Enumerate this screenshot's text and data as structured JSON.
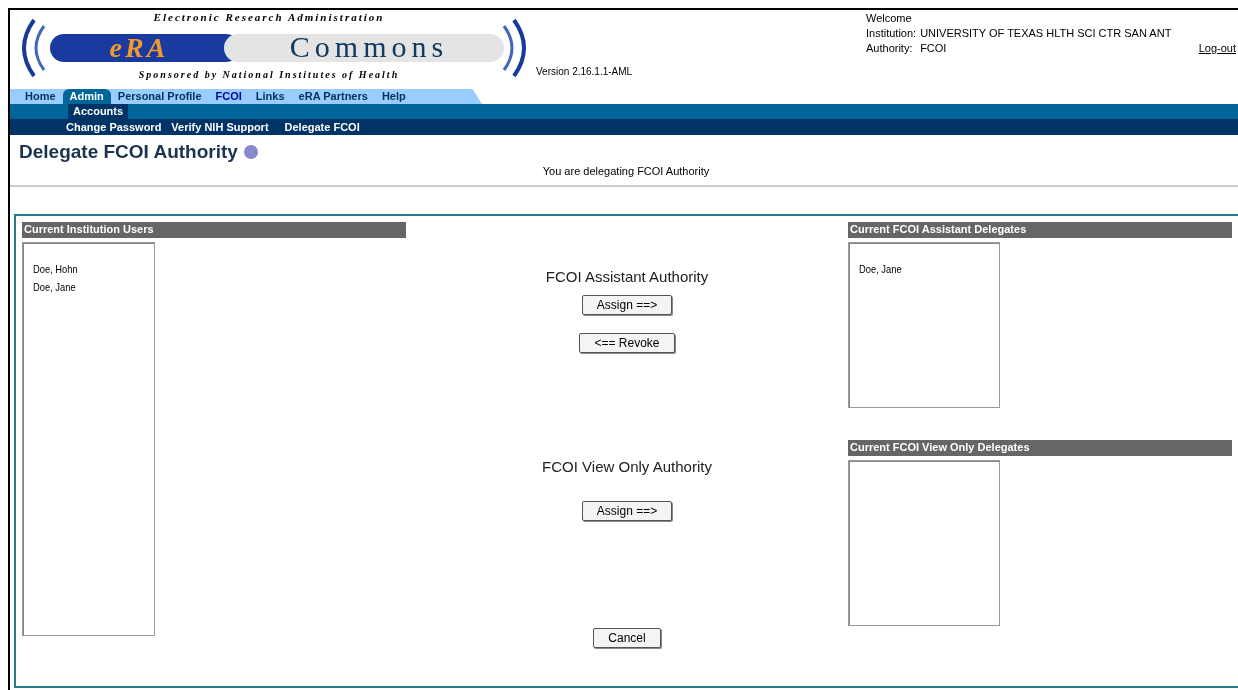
{
  "logo": {
    "top": "Electronic Research Administration",
    "left": "eRA",
    "right": "Commons",
    "bottom": "Sponsored by National Institutes of Health"
  },
  "version": "Version 2.16.1.1-AML",
  "welcome": {
    "greeting": "Welcome",
    "institution_label": "Institution:",
    "institution": "UNIVERSITY OF TEXAS HLTH SCI CTR SAN ANT",
    "authority_label": "Authority:",
    "authority": "FCOI",
    "logout": "Log-out"
  },
  "tabs": [
    {
      "label": "Home",
      "selected": false
    },
    {
      "label": "Admin",
      "selected": true
    },
    {
      "label": "Personal Profile",
      "selected": false
    },
    {
      "label": "FCOI",
      "selected": false
    },
    {
      "label": "Links",
      "selected": false
    },
    {
      "label": "eRA Partners",
      "selected": false
    },
    {
      "label": "Help",
      "selected": false
    }
  ],
  "subtabs": [
    {
      "label": "Accounts",
      "selected": true
    }
  ],
  "sublinks": [
    "Change Password",
    "Verify NIH Support",
    "Delegate FCOI"
  ],
  "page": {
    "title": "Delegate FCOI Authority",
    "message": "You are delegating FCOI Authority"
  },
  "users": {
    "title": "Current Institution Users",
    "items": [
      "Doe, Hohn",
      "Doe, Jane"
    ]
  },
  "assistant": {
    "title": "FCOI Assistant Authority",
    "assign": "Assign ==>",
    "revoke": "<== Revoke"
  },
  "view_only": {
    "title": "FCOI View Only Authority",
    "assign": "Assign ==>"
  },
  "assistant_delegates": {
    "title": "Current FCOI Assistant Delegates",
    "items": [
      "Doe, Jane"
    ]
  },
  "view_only_delegates": {
    "title": "Current FCOI View Only Delegates"
  },
  "cancel": "Cancel"
}
